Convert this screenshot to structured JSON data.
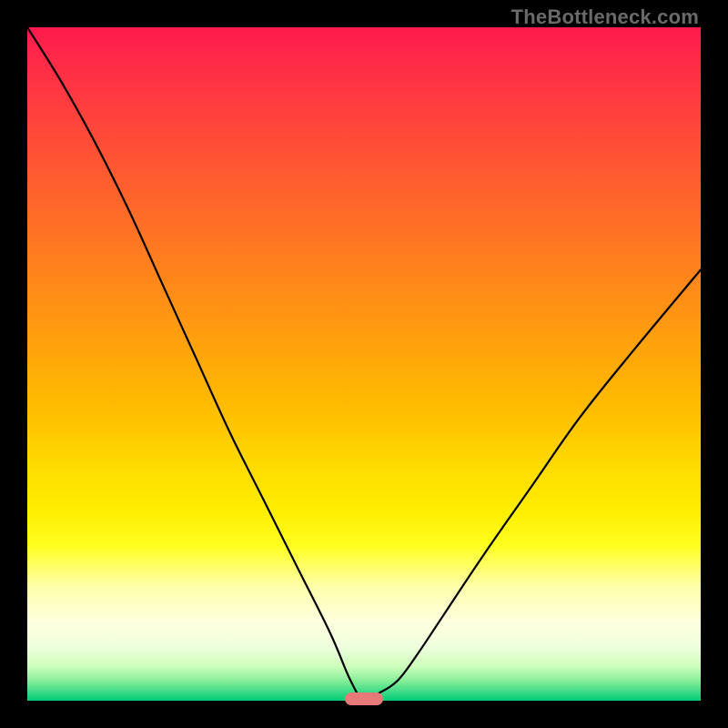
{
  "watermark": "TheBottleneck.com",
  "chart_data": {
    "type": "line",
    "title": "",
    "xlabel": "",
    "ylabel": "",
    "xlim": [
      0,
      100
    ],
    "ylim": [
      0,
      100
    ],
    "series": [
      {
        "name": "bottleneck-curve",
        "x": [
          0,
          5,
          10,
          15,
          20,
          25,
          30,
          35,
          40,
          45,
          48,
          50,
          52,
          55,
          58,
          62,
          68,
          75,
          82,
          90,
          100
        ],
        "values": [
          100,
          92,
          83,
          73,
          62,
          51,
          40,
          30,
          20,
          10,
          3,
          0,
          1,
          3,
          7,
          13,
          22,
          32,
          42,
          52,
          64
        ]
      }
    ],
    "annotations": [
      {
        "name": "optimal-marker",
        "x": 50,
        "y": 0,
        "color": "#e67a78"
      }
    ],
    "background_gradient": {
      "top": "#ff1a4d",
      "mid": "#ffee00",
      "bottom": "#00cc77"
    }
  }
}
